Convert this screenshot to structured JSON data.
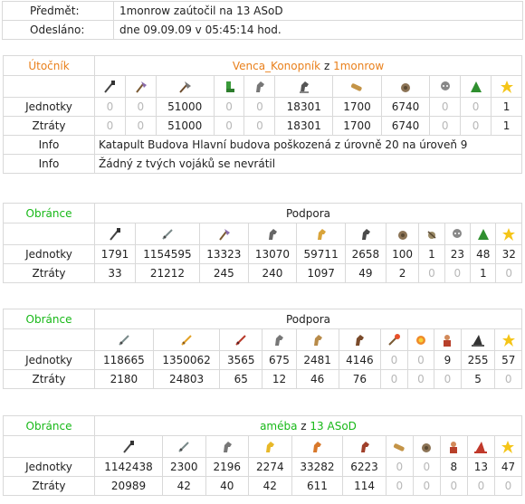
{
  "header": {
    "subject_label": "Předmět:",
    "subject_value": "1monrow zaútočil na 13 ASoD",
    "sent_label": "Odesláno:",
    "sent_value": "dne 09.09.09 v 05:45:14 hod."
  },
  "attacker": {
    "role": "Útočník",
    "player": "Venca_Konopník",
    "z": " z ",
    "village": "1monrow",
    "icons": [
      "spear-icon",
      "axe-icon",
      "ram-axe-icon",
      "boot-icon",
      "horse-icon",
      "knight-horse-icon",
      "catapult-log-icon",
      "ram-icon",
      "noble-icon",
      "pointed-hat-icon",
      "star-icon"
    ],
    "units_label": "Jednotky",
    "losses_label": "Ztráty",
    "units": [
      "0",
      "0",
      "51000",
      "0",
      "0",
      "18301",
      "1700",
      "6740",
      "0",
      "0",
      "1"
    ],
    "losses": [
      "0",
      "0",
      "51000",
      "0",
      "0",
      "18301",
      "1700",
      "6740",
      "0",
      "0",
      "1"
    ],
    "info_label": "Info",
    "info1": "Katapult Budova Hlavní budova poškozená z úrovně 20 na úroveň 9",
    "info2": "Žádný z tvých vojáků se nevrátil"
  },
  "defenders": [
    {
      "role": "Obránce",
      "title": "Podpora",
      "owner": "",
      "z": "",
      "village": "",
      "icons": [
        "spear-icon",
        "sword-icon",
        "axe-icon",
        "scout-icon",
        "light-cavalry-icon",
        "heavy-cavalry-icon",
        "ram-icon",
        "catapult-icon",
        "noble-icon",
        "pointed-hat-icon",
        "star-icon"
      ],
      "units_label": "Jednotky",
      "losses_label": "Ztráty",
      "units": [
        "1791",
        "1154595",
        "13323",
        "13070",
        "59711",
        "2658",
        "100",
        "1",
        "23",
        "48",
        "32"
      ],
      "losses": [
        "33",
        "21212",
        "245",
        "240",
        "1097",
        "49",
        "2",
        "0",
        "0",
        "1",
        "0"
      ]
    },
    {
      "role": "Obránce",
      "title": "Podpora",
      "owner": "",
      "z": "",
      "village": "",
      "icons": [
        "sword-icon",
        "golden-sword-icon",
        "red-sword-icon",
        "horse-icon",
        "horse-tan-icon",
        "horse-brown-icon",
        "fire-arrow-icon",
        "fireball-icon",
        "villager-icon",
        "witch-hat-icon",
        "star-icon"
      ],
      "units_label": "Jednotky",
      "losses_label": "Ztráty",
      "units": [
        "118665",
        "1350062",
        "3565",
        "675",
        "2481",
        "4146",
        "0",
        "0",
        "9",
        "255",
        "57"
      ],
      "losses": [
        "2180",
        "24803",
        "65",
        "12",
        "46",
        "76",
        "0",
        "0",
        "0",
        "5",
        "0"
      ]
    },
    {
      "role": "Obránce",
      "title": "",
      "owner": "améba",
      "z": " z ",
      "village": "13 ASoD",
      "icons": [
        "spear-icon",
        "sword-icon",
        "horse-icon",
        "golden-horse-icon",
        "orange-horse-icon",
        "red-horse-icon",
        "catapult-log-icon",
        "ram-icon",
        "villager-icon",
        "red-hat-icon",
        "star-icon"
      ],
      "units_label": "Jednotky",
      "losses_label": "Ztráty",
      "units": [
        "1142438",
        "2300",
        "2196",
        "2274",
        "33282",
        "6223",
        "0",
        "0",
        "8",
        "13",
        "47"
      ],
      "losses": [
        "20989",
        "42",
        "40",
        "42",
        "611",
        "114",
        "0",
        "0",
        "0",
        "0",
        "0"
      ]
    }
  ]
}
